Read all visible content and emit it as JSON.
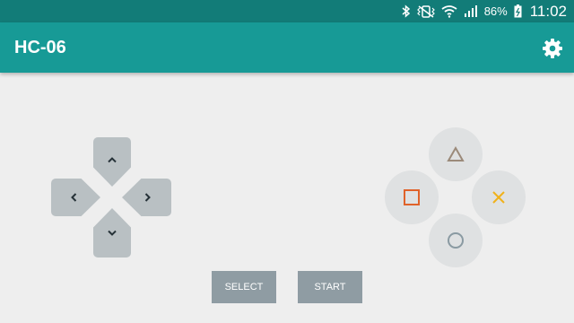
{
  "status_bar": {
    "battery": "86%",
    "time": "11:02",
    "icons": [
      "bluetooth-icon",
      "vibrate-icon",
      "wifi-icon",
      "signal-icon",
      "battery-icon"
    ]
  },
  "app_bar": {
    "title": "HC-06",
    "settings_icon": "gear-icon"
  },
  "dpad": {
    "icons": [
      "chevron-up-icon",
      "chevron-left-icon",
      "chevron-right-icon",
      "chevron-down-icon"
    ]
  },
  "action_buttons": [
    {
      "symbol": "triangle",
      "color": "#9b8a7a"
    },
    {
      "symbol": "square",
      "color": "#e0622a"
    },
    {
      "symbol": "cross",
      "color": "#f0b21b"
    },
    {
      "symbol": "circle",
      "color": "#8a9aa2"
    }
  ],
  "buttons": {
    "select": "SELECT",
    "start": "START"
  },
  "colors": {
    "status_bar": "#127c78",
    "app_bar": "#179a96",
    "background": "#eeeeee",
    "dpad": "#b9c0c3",
    "action_button": "#dfe1e2",
    "pill_button": "#8f9ca3"
  }
}
